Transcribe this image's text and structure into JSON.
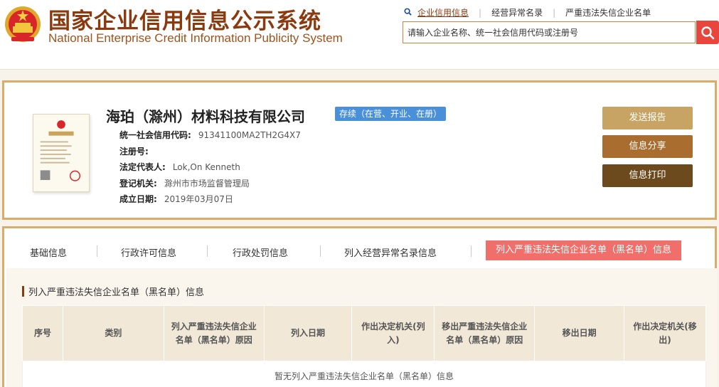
{
  "site": {
    "title_cn": "国家企业信用信息公示系统",
    "title_en": "National Enterprise Credit Information Publicity System"
  },
  "top_links": {
    "search_icon": "search-icon",
    "items": [
      "企业信用信息",
      "经营异常名录",
      "严重违法失信企业名单"
    ]
  },
  "search": {
    "placeholder": "请输入企业名称、统一社会信用代码或注册号",
    "value": ""
  },
  "company": {
    "name": "海珀（滁州）材料科技有限公司",
    "status": "存续（在营、开业、在册）",
    "fields": [
      {
        "label": "统一社会信用代码:",
        "value": "91341100MA2TH2G4X7"
      },
      {
        "label": "注册号:",
        "value": ""
      },
      {
        "label": "法定代表人:",
        "value": "Lok,On Kenneth"
      },
      {
        "label": "登记机关:",
        "value": "滁州市市场监督管理局"
      },
      {
        "label": "成立日期:",
        "value": "2019年03月07日"
      }
    ]
  },
  "actions": {
    "report": "发送报告",
    "share": "信息分享",
    "print": "信息打印"
  },
  "tabs": [
    {
      "label": "基础信息",
      "active": false
    },
    {
      "label": "行政许可信息",
      "active": false
    },
    {
      "label": "行政处罚信息",
      "active": false
    },
    {
      "label": "列入经营异常名录信息",
      "active": false
    },
    {
      "label": "列入严重违法失信企业名单（黑名单）信息",
      "active": true
    }
  ],
  "section": {
    "title": "列入严重违法失信企业名单（黑名单）信息",
    "columns": [
      "序号",
      "类别",
      "列入严重违法失信企业名单（黑名单）原因",
      "列入日期",
      "作出决定机关(列入)",
      "移出严重违法失信企业名单（黑名单）原因",
      "移出日期",
      "作出决定机关(移出)"
    ],
    "empty_text": "暂无列入严重违法失信企业名单（黑名单）信息"
  },
  "colors": {
    "brand": "#8b3a0f",
    "border_gold": "#d8ad6a",
    "status_blue": "#4a90d9",
    "active_tab": "#f06f6a",
    "search_red": "#e8453c"
  }
}
